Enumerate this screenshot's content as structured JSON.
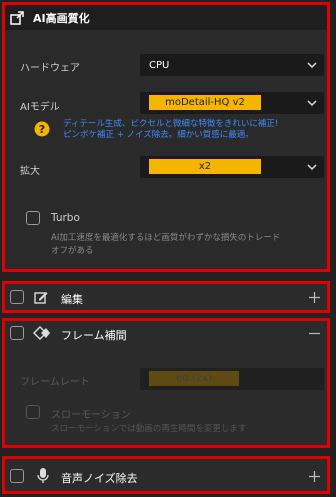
{
  "ai_hq": {
    "title": "AI高画質化",
    "hardware_label": "ハードウェア",
    "hardware_value": "CPU",
    "model_label": "AIモデル",
    "model_value": "moDetail-HQ  v2",
    "model_hint": "ディテール生成、ピクセルと微細な特徴をきれいに補正!ピンボケ補正 + ノイズ除去。細かい質感に最適。",
    "model_hint_line1": "ディテール生成、ピクセルと微細な特徴をきれいに補正!",
    "model_hint_line2": "ピンボケ補正 + ノイズ除去。細かい質感に最適。",
    "scale_label": "拡大",
    "scale_value": "x2",
    "turbo_label": "Turbo",
    "turbo_note_line1": "AI加工速度を最適化するほど画質がわずかな損失のトレード",
    "turbo_note_line2": "オフがある"
  },
  "edit": {
    "title": "編集"
  },
  "frame_interp": {
    "title": "フレーム補間",
    "framerate_label": "フレームレート",
    "framerate_value": "60 (2x)",
    "slowmo_label": "スローモーション",
    "slowmo_note": "スローモーションでは動画の再生時間を変更します"
  },
  "denoise": {
    "title": "音声ノイズ除去"
  },
  "colors": {
    "accent": "#f5b400",
    "hint": "#3d8bff",
    "highlight_border": "#e00000"
  },
  "icons": [
    "enhance-icon",
    "chevron-down-icon",
    "help-icon",
    "edit-icon",
    "frame-interpolation-icon",
    "microphone-icon",
    "plus-icon",
    "minus-icon"
  ]
}
